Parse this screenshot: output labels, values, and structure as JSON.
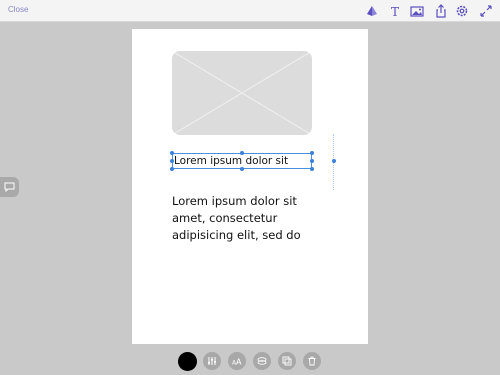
{
  "topbar": {
    "close_label": "Close",
    "icons": [
      "layers-icon",
      "text-icon",
      "image-icon",
      "share-icon",
      "settings-icon",
      "fullscreen-icon"
    ]
  },
  "accent_color": "#7066c4",
  "canvas": {
    "selected_text": "Lorem ipsum dolor sit",
    "body_text": "Lorem ipsum dolor sit amet, consectetur adipisicing elit, sed do"
  },
  "bottom_toolbar": {
    "color": "#000000",
    "tools": [
      "color-swatch",
      "adjust-icon",
      "font-size-icon",
      "layer-order-icon",
      "duplicate-icon",
      "delete-icon"
    ]
  }
}
